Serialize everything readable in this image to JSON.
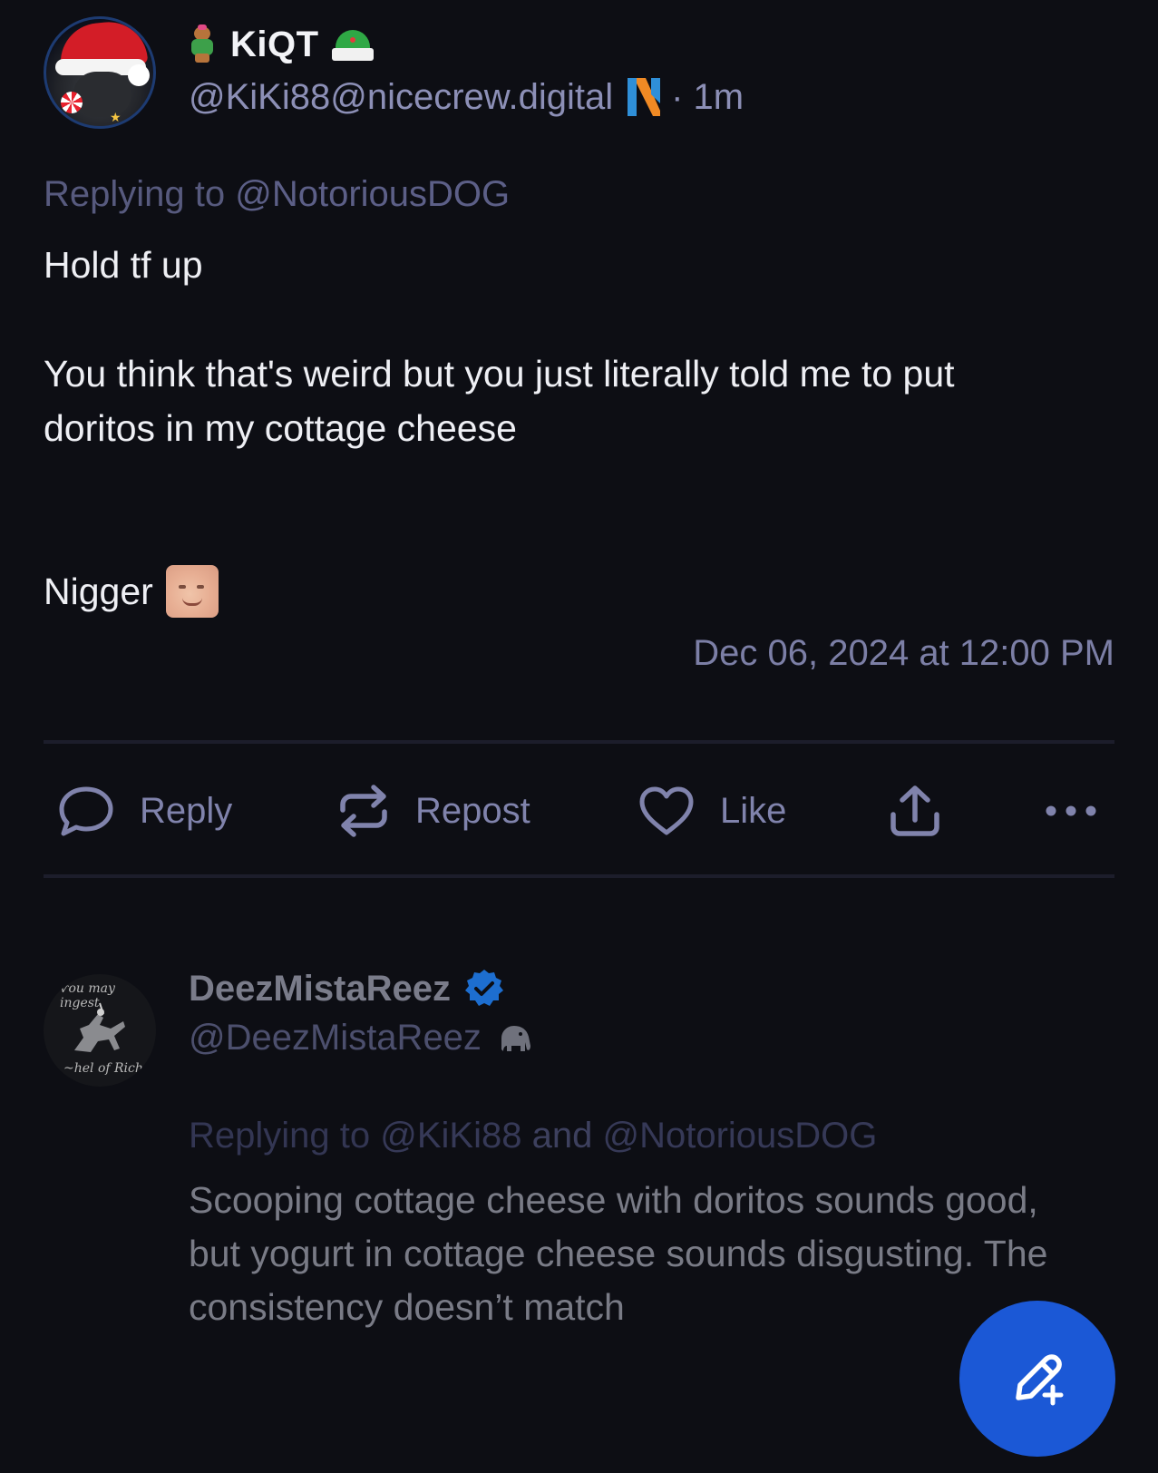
{
  "post": {
    "display_name": "KiQT",
    "handle": "@KiKi88@nicecrew.digital",
    "time_ago": "· 1m",
    "replying_prefix": "Replying to",
    "replying_mention": "@NotoriousDOG",
    "body_line1": "Hold tf up",
    "body_line2": "You think that's weird but you just literally told me to put doritos in my cottage cheese",
    "body_line3": "Nigger",
    "timestamp": "Dec 06, 2024 at 12:00 PM",
    "name_icons": [
      "gingerbread-icon",
      "elf-hat-icon"
    ],
    "server_icon": "nostr-n-icon"
  },
  "actions": {
    "reply_label": "Reply",
    "repost_label": "Repost",
    "like_label": "Like",
    "share_icon": "share-upload-icon",
    "more_icon": "more-dots-icon"
  },
  "reply": {
    "display_name": "DeezMistaReez",
    "handle": "@DeezMistaReez",
    "verified_icon": "verified-badge-icon",
    "platform_icon": "elephant-icon",
    "replying_prefix": "Replying to",
    "mention1": "@KiKi88",
    "and_word": "and",
    "mention2": "@NotoriousDOG",
    "body": "Scooping cottage cheese with doritos sounds good, but yogurt in cottage cheese sounds disgusting. The consistency doesn’t match"
  },
  "fab": {
    "icon": "compose-pencil-icon"
  },
  "colors": {
    "background": "#0d0e14",
    "accent_blue": "#1b58d6",
    "muted_text": "#7c7fa6"
  }
}
